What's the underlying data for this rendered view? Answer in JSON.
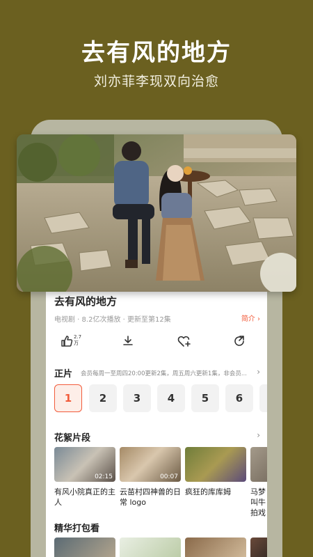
{
  "promo": {
    "title": "去有风的地方",
    "subtitle": "刘亦菲李现双向治愈"
  },
  "show": {
    "title": "去有风的地方",
    "meta": "电视剧 · 8.2亿次播放 · 更新至第12集",
    "intro_label": "简介 ›"
  },
  "actions": {
    "like_count": "2.7万",
    "icons": [
      "thumbs-up-icon",
      "download-icon",
      "add-favorite-icon",
      "share-icon"
    ]
  },
  "episodes_section": {
    "title": "正片",
    "note": "会员每周一至周四20:00更新2集，周五周六更新1集，非会员...",
    "chevron": "›",
    "items": [
      "1",
      "2",
      "3",
      "4",
      "5",
      "6"
    ]
  },
  "clips_section": {
    "title": "花絮片段",
    "chevron": "›",
    "items": [
      {
        "caption": "有风小院真正的主人",
        "duration": "02:15"
      },
      {
        "caption": "云苗村四神兽的日常 logo",
        "duration": "00:07"
      },
      {
        "caption": "疯狂的库库姆",
        "duration": ""
      },
      {
        "caption": "马梦叫牛拍戏",
        "duration": ""
      }
    ]
  },
  "highlights_section": {
    "title": "精华打包看"
  },
  "colors": {
    "background": "#6b6020",
    "accent": "#f25b3a",
    "frame": "#b7b6a1"
  }
}
